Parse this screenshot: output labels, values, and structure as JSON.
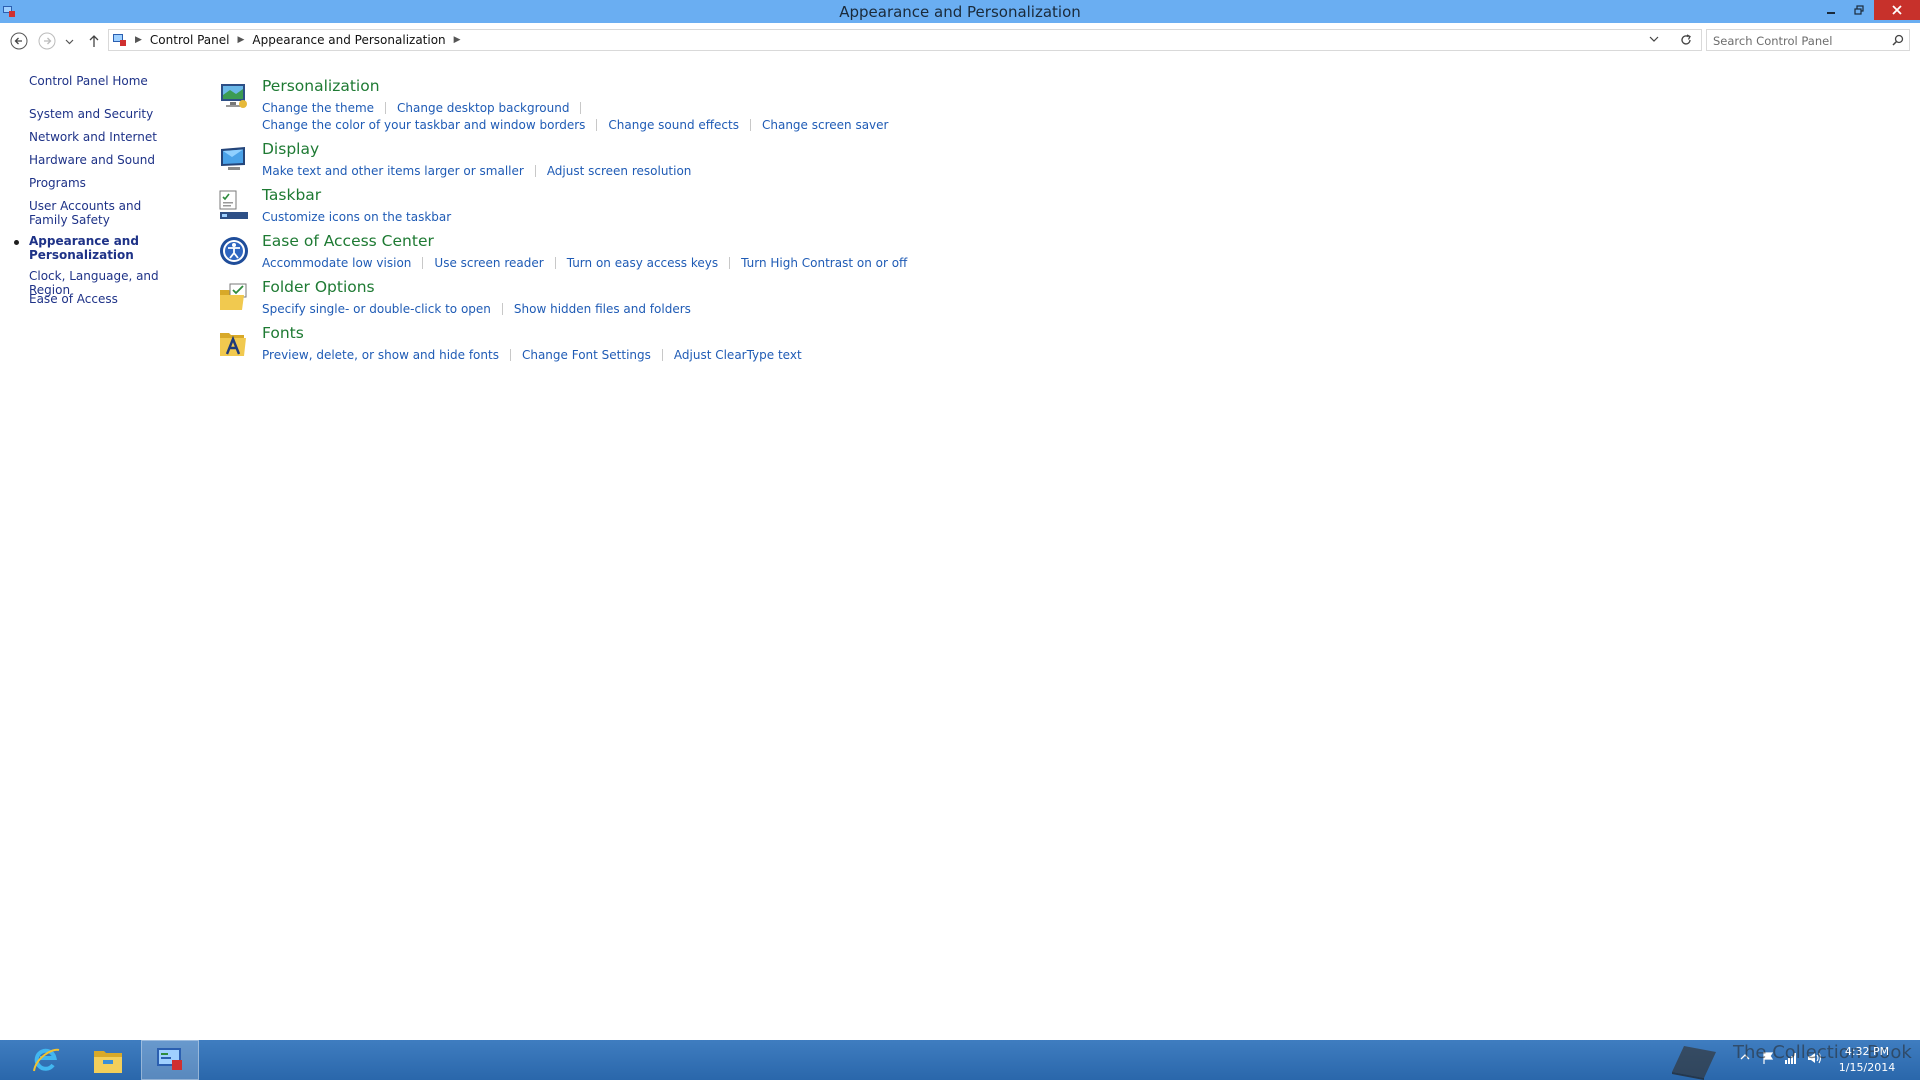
{
  "window": {
    "title": "Appearance and Personalization"
  },
  "address_bar": {
    "breadcrumbs": [
      "Control Panel",
      "Appearance and Personalization"
    ]
  },
  "search": {
    "placeholder": "Search Control Panel"
  },
  "left_nav": {
    "items": [
      {
        "label": "Control Panel Home"
      },
      {
        "label": "System and Security"
      },
      {
        "label": "Network and Internet"
      },
      {
        "label": "Hardware and Sound"
      },
      {
        "label": "Programs"
      },
      {
        "label": "User Accounts and Family Safety"
      },
      {
        "label": "Appearance and Personalization",
        "current": true
      },
      {
        "label": "Clock, Language, and Region"
      },
      {
        "label": "Ease of Access"
      }
    ]
  },
  "categories": [
    {
      "title": "Personalization",
      "icon": "personalization-icon",
      "links": [
        "Change the theme",
        "Change desktop background",
        "Change the color of your taskbar and window borders",
        "Change sound effects",
        "Change screen saver"
      ]
    },
    {
      "title": "Display",
      "icon": "display-icon",
      "links": [
        "Make text and other items larger or smaller",
        "Adjust screen resolution"
      ]
    },
    {
      "title": "Taskbar",
      "icon": "taskbar-icon",
      "links": [
        "Customize icons on the taskbar"
      ]
    },
    {
      "title": "Ease of Access Center",
      "icon": "ease-of-access-icon",
      "links": [
        "Accommodate low vision",
        "Use screen reader",
        "Turn on easy access keys",
        "Turn High Contrast on or off"
      ]
    },
    {
      "title": "Folder Options",
      "icon": "folder-options-icon",
      "links": [
        "Specify single- or double-click to open",
        "Show hidden files and folders"
      ]
    },
    {
      "title": "Fonts",
      "icon": "fonts-icon",
      "links": [
        "Preview, delete, or show and hide fonts",
        "Change Font Settings",
        "Adjust ClearType text"
      ]
    }
  ],
  "taskbar": {
    "apps": [
      "internet-explorer-icon",
      "file-explorer-icon",
      "control-panel-icon"
    ],
    "watermark": "The Collection Book",
    "clock": {
      "time": "4:32 PM",
      "date": "1/15/2014"
    }
  },
  "colors": {
    "titlebar": "#6aaef2",
    "category_title": "#1e7a33",
    "task_link": "#1f5bb5",
    "nav_link": "#1e3287",
    "taskbar": "#2f6fb4",
    "close_button": "#c7312b"
  }
}
